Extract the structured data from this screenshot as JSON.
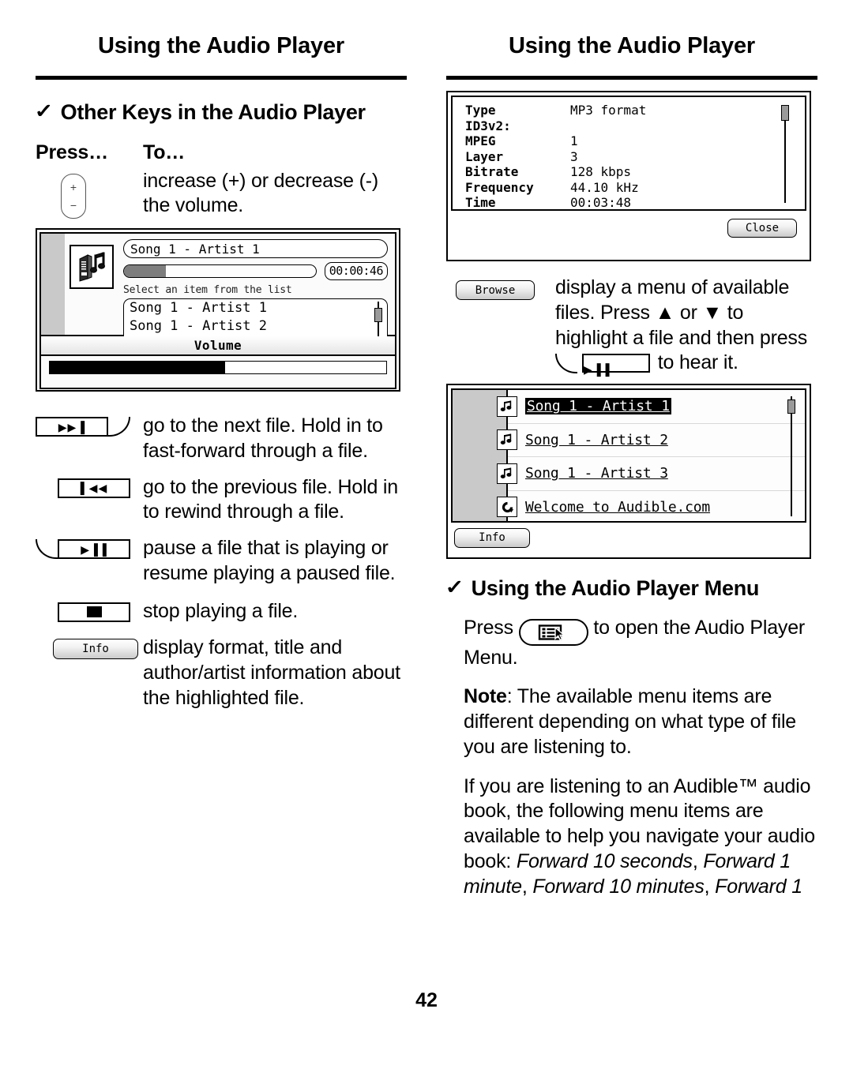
{
  "page": {
    "number": "42",
    "running_head_left": "Using the Audio Player",
    "running_head_right": "Using the Audio Player"
  },
  "left_column": {
    "section_heading": "Other Keys in the Audio Player",
    "check_glyph": "✓",
    "table_headers": {
      "press": "Press…",
      "to": "To…"
    },
    "rows": [
      {
        "key_name": "volume-rocker-key",
        "key_plus": "+",
        "key_minus": "−",
        "description": "increase (+) or decrease (-) the volume."
      },
      {
        "key_name": "next-file-key",
        "key_glyph": "▶▶▐",
        "description": "go to the next file. Hold in to fast-forward through a file."
      },
      {
        "key_name": "previous-file-key",
        "key_glyph": "▌◀◀",
        "description": "go to the previous file. Hold in to rewind through a file."
      },
      {
        "key_name": "play-pause-key",
        "key_glyph": "▶▐▐",
        "description": "pause a file that is playing or resume playing a paused file."
      },
      {
        "key_name": "stop-key",
        "key_glyph": "■",
        "description": "stop playing a file."
      },
      {
        "key_name": "info-key",
        "key_label": "Info",
        "description": "display format, title and author/artist information about the highlighted file."
      }
    ],
    "player_screen": {
      "title": "Song 1 - Artist 1",
      "elapsed_time": "00:00:46",
      "progress_percent": 22,
      "hint": "Select an item from the list",
      "list": [
        {
          "label": "Song 1 - Artist 1",
          "selected": true
        },
        {
          "label": "Song 1 - Artist 2",
          "selected": false
        }
      ],
      "volume_label": "Volume",
      "volume_percent": 52
    }
  },
  "right_column": {
    "info_dialog": {
      "fields": [
        {
          "key": "Type",
          "value": "MP3 format"
        },
        {
          "key": "ID3v2:",
          "value": ""
        },
        {
          "key": "MPEG",
          "value": "1"
        },
        {
          "key": "Layer",
          "value": "3"
        },
        {
          "key": "Bitrate",
          "value": "128  kbps"
        },
        {
          "key": "Frequency",
          "value": "44.10  kHz"
        },
        {
          "key": "Time",
          "value": "00:03:48"
        }
      ],
      "close_label": "Close"
    },
    "browse_row": {
      "key_label": "Browse",
      "text_before": "display a menu of available files. Press ▲ or ▼ to highlight a file and then press",
      "inline_key_glyph": "▶▐▐",
      "text_after": "to hear it."
    },
    "browse_screen": {
      "items": [
        {
          "label": "Song 1 - Artist 1",
          "icon": "music-note-icon",
          "selected": true
        },
        {
          "label": "Song 1 - Artist 2",
          "icon": "music-note-icon",
          "selected": false
        },
        {
          "label": "Song 1 - Artist 3",
          "icon": "music-note-icon",
          "selected": false
        },
        {
          "label": "Welcome to Audible.com",
          "icon": "audible-arrow-icon",
          "selected": false
        }
      ],
      "info_label": "Info"
    },
    "section_heading": "Using the Audio Player Menu",
    "check_glyph": "✓",
    "menu_paragraph_before": "Press",
    "menu_paragraph_after": "to open the Audio Player Menu.",
    "note_label": "Note",
    "note_text": ": The available menu items are different depending on what type of file you are listening to.",
    "audible_paragraph_plain": "If you are listening to an Audible™ audio book, the following menu items are available to help you navigate your audio book: ",
    "audible_paragraph_italic_1": "Forward 10 seconds",
    "audible_sep_1": ", ",
    "audible_paragraph_italic_2": "Forward 1 minute",
    "audible_sep_2": ", ",
    "audible_paragraph_italic_3": "Forward 10 minutes",
    "audible_sep_3": ", ",
    "audible_paragraph_italic_4": "Forward 1"
  }
}
